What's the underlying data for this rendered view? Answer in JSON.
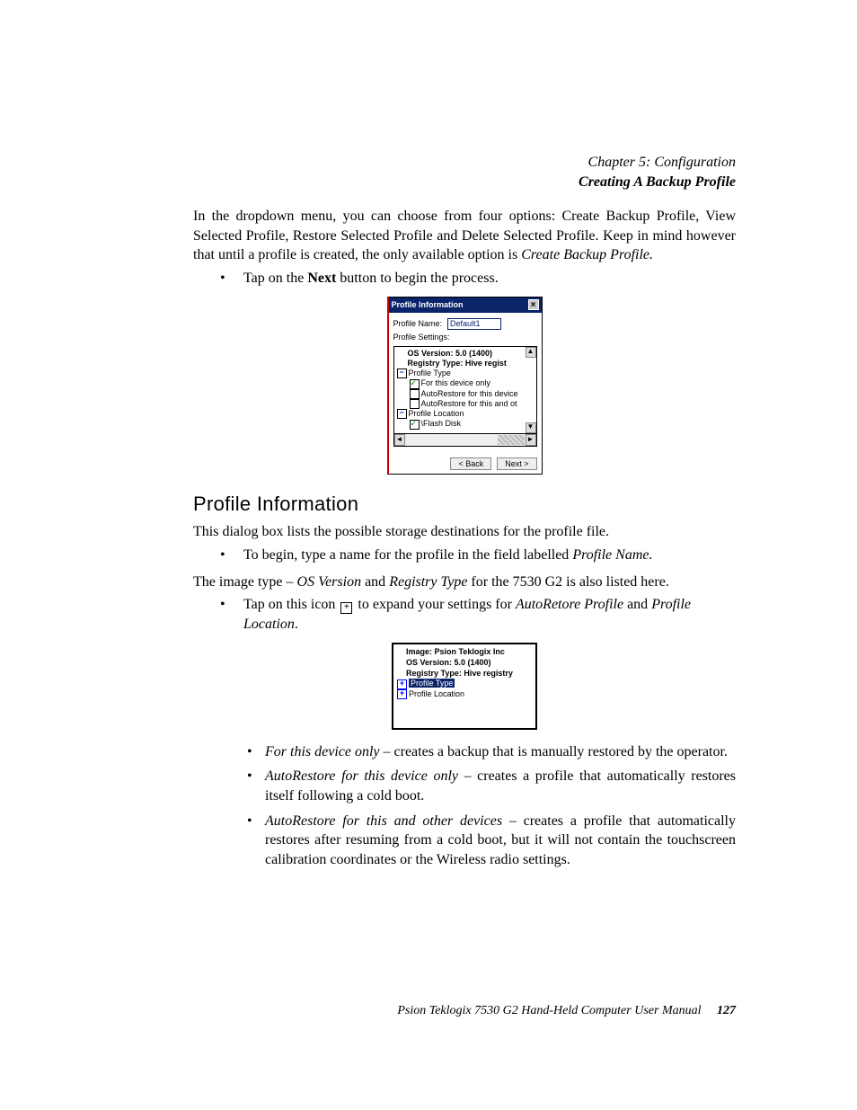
{
  "header": {
    "chapter": "Chapter 5: Configuration",
    "section": "Creating A Backup Profile"
  },
  "intro": {
    "p1a": "In the dropdown menu, you can choose from four options: Create Backup Profile, View Selected Profile, Restore Selected Profile and Delete Selected Profile. Keep in mind however that until a profile is created, the only available option is ",
    "p1b": "Create Backup Profile.",
    "bullet1a": "Tap on the ",
    "bullet1b": "Next",
    "bullet1c": " button to begin the process."
  },
  "dialog": {
    "title": "Profile Information",
    "close": "×",
    "profile_name_label": "Profile Name:",
    "profile_name_value": "Default1",
    "profile_settings_label": "Profile Settings:",
    "tree": {
      "line1": "OS Version: 5.0 (1400)",
      "line2": "Registry Type: Hive regist",
      "line3": "Profile Type",
      "line4": "For this device only",
      "line5": "AutoRestore for this device",
      "line6": "AutoRestore for this and ot",
      "line7": "Profile Location",
      "line8": "\\Flash Disk"
    },
    "back": "< Back",
    "next": "Next >"
  },
  "section_heading": "Profile Information",
  "para2": "This dialog box lists the possible storage destinations for the profile file.",
  "bullet2a": "To begin, type a name for the profile in the field labelled ",
  "bullet2b": "Profile Name.",
  "para3a": "The image type – ",
  "para3b": "OS Version",
  "para3c": " and ",
  "para3d": "Registry Type",
  "para3e": " for the 7530 G2 is also listed here.",
  "bullet3a": "Tap on this icon ",
  "bullet3b": " to expand your settings for ",
  "bullet3c": "AutoRetore Profile",
  "bullet3d": " and ",
  "bullet3e": "Profile Location",
  "bullet3f": ".",
  "smalltree": {
    "l1": "Image: Psion Teklogix Inc",
    "l2": "OS Version: 5.0 (1400)",
    "l3": "Registry Type: Hive registry",
    "l4": "Profile Type",
    "l5": "Profile Location"
  },
  "optlist": {
    "o1a": "For this device only",
    "o1b": " – creates a backup that is manually restored by the operator.",
    "o2a": "AutoRestore for this device only",
    "o2b": " – creates a profile that automatically restores itself following a cold boot.",
    "o3a": "AutoRestore for this and other devices",
    "o3b": " – creates a profile that automatically restores after resuming from a cold boot, but it will not contain the touchscreen calibration coordinates or the Wireless radio settings."
  },
  "footer": {
    "text": "Psion Teklogix 7530 G2 Hand-Held Computer User Manual",
    "page": "127"
  },
  "icons": {
    "plus": "+",
    "minus": "−",
    "left": "◄",
    "right": "►",
    "up": "▲",
    "down": "▼"
  }
}
